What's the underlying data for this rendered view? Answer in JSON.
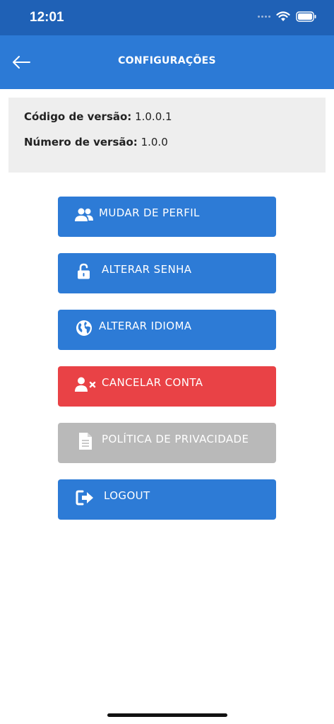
{
  "status_bar": {
    "time": "12:01"
  },
  "header": {
    "title": "CONFIGURAÇÕES"
  },
  "version": {
    "code_label": "Código de versão:",
    "code_value": "1.0.0.1",
    "number_label": "Número de versão:",
    "number_value": "1.0.0"
  },
  "buttons": [
    {
      "label": "MUDAR DE PERFIL",
      "icon": "users-icon",
      "color": "#2d7bd6"
    },
    {
      "label": "ALTERAR SENHA",
      "icon": "unlock-icon",
      "color": "#2d7bd6"
    },
    {
      "label": "ALTERAR IDIOMA",
      "icon": "globe-icon",
      "color": "#2d7bd6"
    },
    {
      "label": "CANCELAR CONTA",
      "icon": "user-remove-icon",
      "color": "#e94246"
    },
    {
      "label": "POLÍTICA DE PRIVACIDADE",
      "icon": "document-icon",
      "color": "#b9b9b9"
    },
    {
      "label": "LOGOUT",
      "icon": "sign-out-icon",
      "color": "#2d7bd6"
    }
  ],
  "colors": {
    "primary": "#2c7ad6",
    "status_bar": "#1f61b6",
    "danger": "#e94246",
    "disabled": "#b9b9b9"
  }
}
